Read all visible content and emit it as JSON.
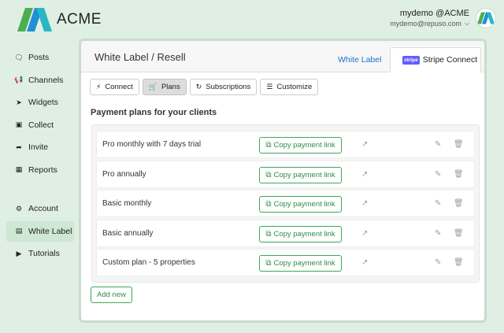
{
  "header": {
    "logo_text": "ACME",
    "user_name": "mydemo @ACME",
    "user_email": "mydemo@repuso.com"
  },
  "sidebar": {
    "items": [
      {
        "label": "Posts",
        "icon": "chat-bubble-icon"
      },
      {
        "label": "Channels",
        "icon": "megaphone-icon"
      },
      {
        "label": "Widgets",
        "icon": "rocket-icon"
      },
      {
        "label": "Collect",
        "icon": "inbox-icon"
      },
      {
        "label": "Invite",
        "icon": "paper-plane-icon"
      },
      {
        "label": "Reports",
        "icon": "bar-chart-icon"
      },
      {
        "label": "Account",
        "icon": "gear-icon"
      },
      {
        "label": "White Label",
        "icon": "credit-card-icon"
      },
      {
        "label": "Tutorials",
        "icon": "video-camera-icon"
      }
    ],
    "active": "White Label"
  },
  "panel": {
    "title": "White Label / Resell",
    "tabs": [
      {
        "label": "White Label"
      },
      {
        "label": "Stripe Connect",
        "badge": "stripe"
      }
    ],
    "buttons": [
      {
        "label": "Connect",
        "icon": "plug-icon"
      },
      {
        "label": "Plans",
        "icon": "cart-icon"
      },
      {
        "label": "Subscriptions",
        "icon": "refresh-icon"
      },
      {
        "label": "Customize",
        "icon": "list-icon"
      }
    ],
    "active_button": "Plans",
    "section_title": "Payment plans for your clients",
    "copy_label": "Copy payment link",
    "plans": [
      {
        "name": "Pro monthly with 7 days trial"
      },
      {
        "name": "Pro annually"
      },
      {
        "name": "Basic monthly"
      },
      {
        "name": "Basic annually"
      },
      {
        "name": "Custom plan - 5 properties"
      }
    ],
    "add_label": "Add new"
  },
  "colors": {
    "accent_green": "#3aa85a",
    "link_blue": "#1a73c8",
    "background": "#dfefe3",
    "stripe_purple": "#635bff"
  }
}
